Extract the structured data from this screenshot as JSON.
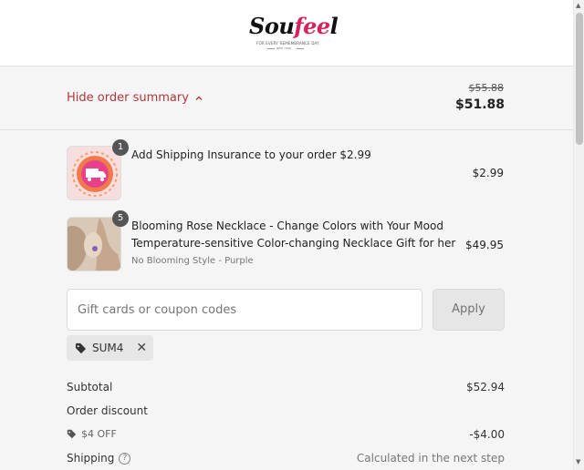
{
  "brand": {
    "logo_text_a": "Sou",
    "logo_text_b": "fee",
    "logo_text_c": "l",
    "tagline": "FOR EVERY REMEMBRANCE DAY",
    "sub_tagline": "NEW YORK"
  },
  "summary": {
    "toggle_label": "Hide order summary",
    "original_total": "$55.88",
    "total": "$51.88",
    "accent_color": "#b1373a"
  },
  "items": [
    {
      "quantity": "1",
      "name_line1": "Add Shipping Insurance to your order $2.99",
      "price": "$2.99",
      "thumb_icon": "shipping-truck-icon"
    },
    {
      "quantity": "5",
      "name_line1": "Blooming Rose Necklace - Change Colors with Your Mood",
      "name_line2": "Temperature-sensitive Color-changing Necklace Gift for her",
      "variant": "No Blooming Style - Purple",
      "price": "$49.95",
      "thumb_icon": "necklace-photo"
    }
  ],
  "coupon": {
    "placeholder": "Gift cards or coupon codes",
    "apply_label": "Apply",
    "applied_code": "SUM4"
  },
  "totals": {
    "subtotal_label": "Subtotal",
    "subtotal_value": "$52.94",
    "discount_label": "Order discount",
    "discount_tag": "$4 OFF",
    "discount_value": "-$4.00",
    "shipping_label": "Shipping",
    "shipping_value": "Calculated in the next step"
  }
}
